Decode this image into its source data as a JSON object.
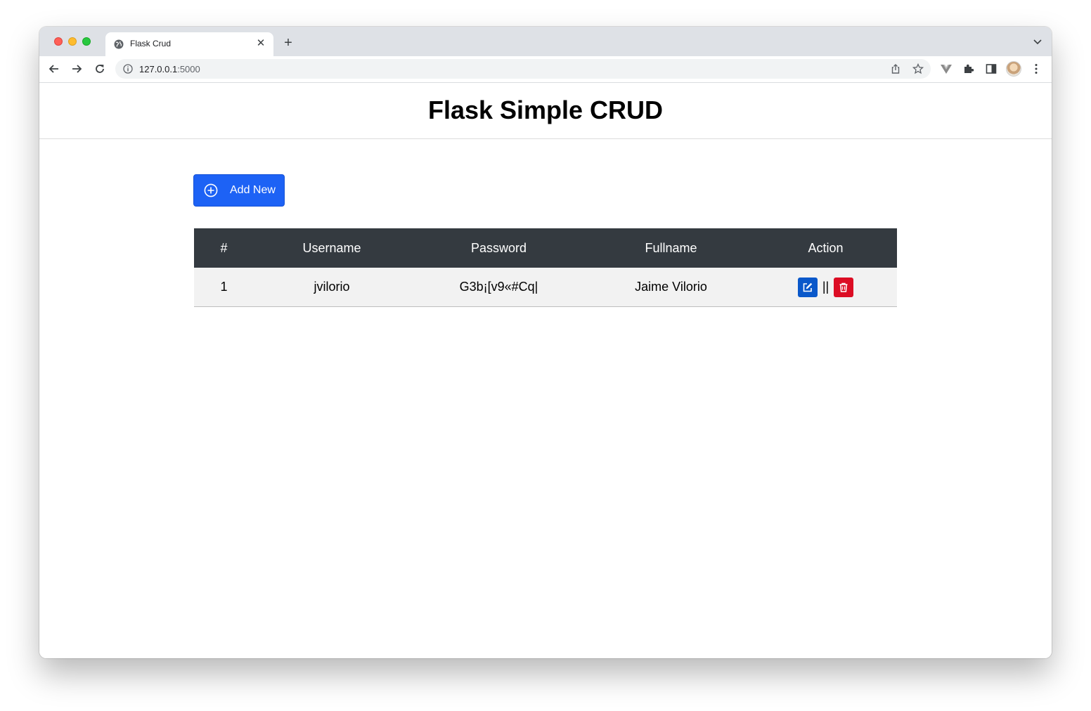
{
  "browser": {
    "tab_title": "Flask Crud",
    "url_host": "127.0.0.1",
    "url_port": ":5000"
  },
  "page": {
    "title": "Flask Simple CRUD",
    "add_button_label": "Add New"
  },
  "table": {
    "headers": [
      "#",
      "Username",
      "Password",
      "Fullname",
      "Action"
    ],
    "rows": [
      {
        "num": "1",
        "username": "jvilorio",
        "password": "G3b¡[v9«#Cq|",
        "fullname": "Jaime Vilorio",
        "separator": "||"
      }
    ]
  },
  "colors": {
    "header_bg": "#343a40",
    "add_button": "#1d62f5",
    "edit_button": "#0a58ca",
    "delete_button": "#dc0d24"
  },
  "icons": {
    "add": "plus-circle-icon",
    "edit": "pencil-square-icon",
    "delete": "trash-icon"
  }
}
